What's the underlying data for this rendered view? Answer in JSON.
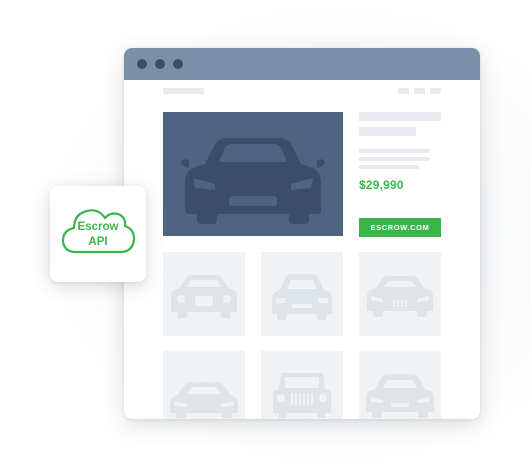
{
  "listing": {
    "price": "$29,990",
    "cta_label": "ESCROW.COM"
  },
  "api_card": {
    "line1": "Escrow",
    "line2": "API",
    "icon": "cloud-icon"
  },
  "colors": {
    "accent": "#3bb54a",
    "titlebar": "#7a91a9",
    "hero": "#4d6580",
    "placeholder": "#e8ecf0",
    "tile": "#f0f3f6"
  }
}
